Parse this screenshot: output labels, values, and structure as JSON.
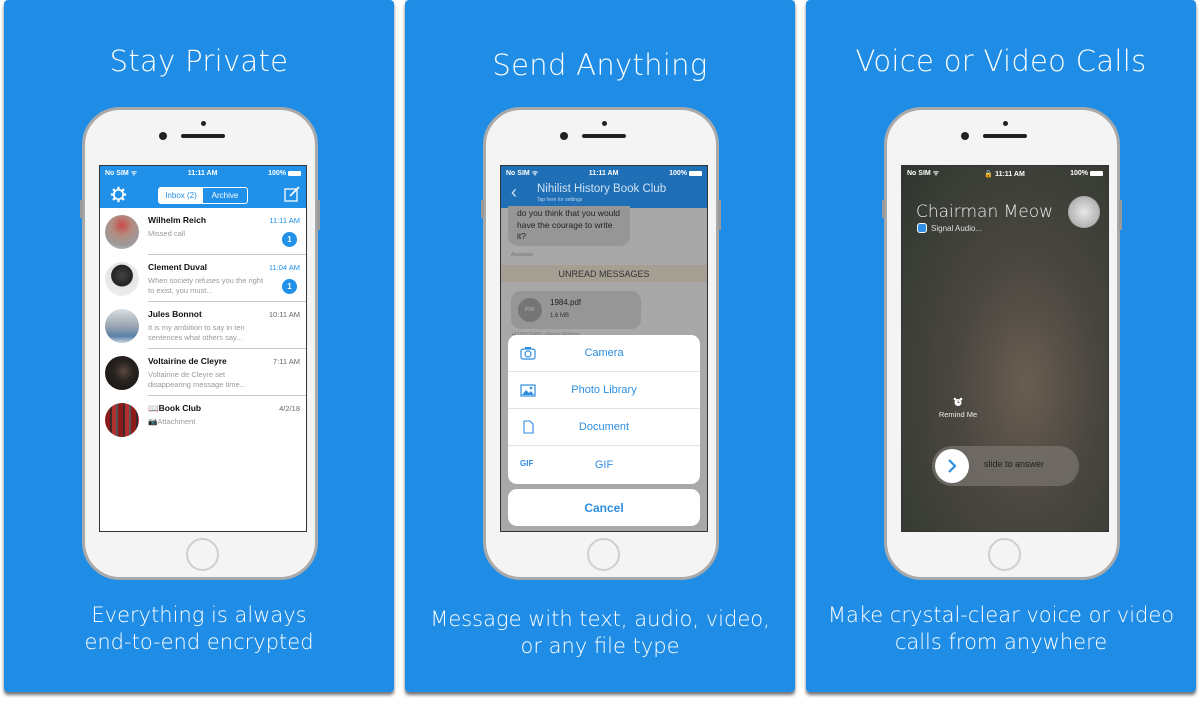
{
  "panels": [
    {
      "title": "Stay Private",
      "caption": [
        "Everything is always",
        "end-to-end encrypted"
      ]
    },
    {
      "title": "Send Anything",
      "caption": [
        "Message with text, audio, video,",
        "or any file type"
      ]
    },
    {
      "title": "Voice or Video Calls",
      "caption": [
        "Make crystal-clear voice or video",
        "calls from anywhere"
      ]
    }
  ],
  "statusbar": {
    "carrier": "No SIM",
    "time": "11:11 AM",
    "battery": "100%"
  },
  "colors": {
    "panel_bg": "#1f8de6",
    "accent": "#2090e8",
    "chat_header": "#1f6fb6"
  },
  "inbox": {
    "tabs": [
      "Inbox (2)",
      "Archive"
    ],
    "active_tab": 0,
    "icons": {
      "left": "gear-icon",
      "right": "compose-icon"
    },
    "conversations": [
      {
        "name": "Wilhelm Reich",
        "time": "11:11 AM",
        "snippet": "Missed call",
        "unread": 1
      },
      {
        "name": "Clement Duval",
        "time": "11:04 AM",
        "snippet": "When society refuses you the right to exist, you must...",
        "unread": 1
      },
      {
        "name": "Jules Bonnot",
        "time": "10:11 AM",
        "snippet": "It is my ambition to say in ten sentences what others say...",
        "unread": 0
      },
      {
        "name": "Voltairine de Cleyre",
        "time": "7:11 AM",
        "snippet": "Voltairine de Cleyre set disappearing message time...",
        "unread": 0
      },
      {
        "name": "📖Book Club",
        "time": "4/2/18",
        "snippet": "📷Attachment",
        "unread": 0
      }
    ]
  },
  "chat": {
    "title": "Nihilist History Book Club",
    "subtitle": "Tap here for settings",
    "message": "do you think that you would have the courage to write it?",
    "message_sender": "Anastasia",
    "unread_banner": "UNREAD MESSAGES",
    "attachment": {
      "name": "1984.pdf",
      "size": "1.6 MB",
      "icon_label": "PDF"
    },
    "attachment_sender": "+4155532400 ~Nestor Makhno",
    "action_sheet": [
      {
        "label": "Camera",
        "icon": "camera-icon"
      },
      {
        "label": "Photo Library",
        "icon": "photo-library-icon"
      },
      {
        "label": "Document",
        "icon": "document-icon"
      },
      {
        "label": "GIF",
        "icon": "gif-icon",
        "icon_text": "GIF"
      }
    ],
    "cancel": "Cancel"
  },
  "call": {
    "caller": "Chairman Meow",
    "app_label": "Signal Audio...",
    "remind_me": "Remind Me",
    "slide_label": "slide to answer"
  }
}
